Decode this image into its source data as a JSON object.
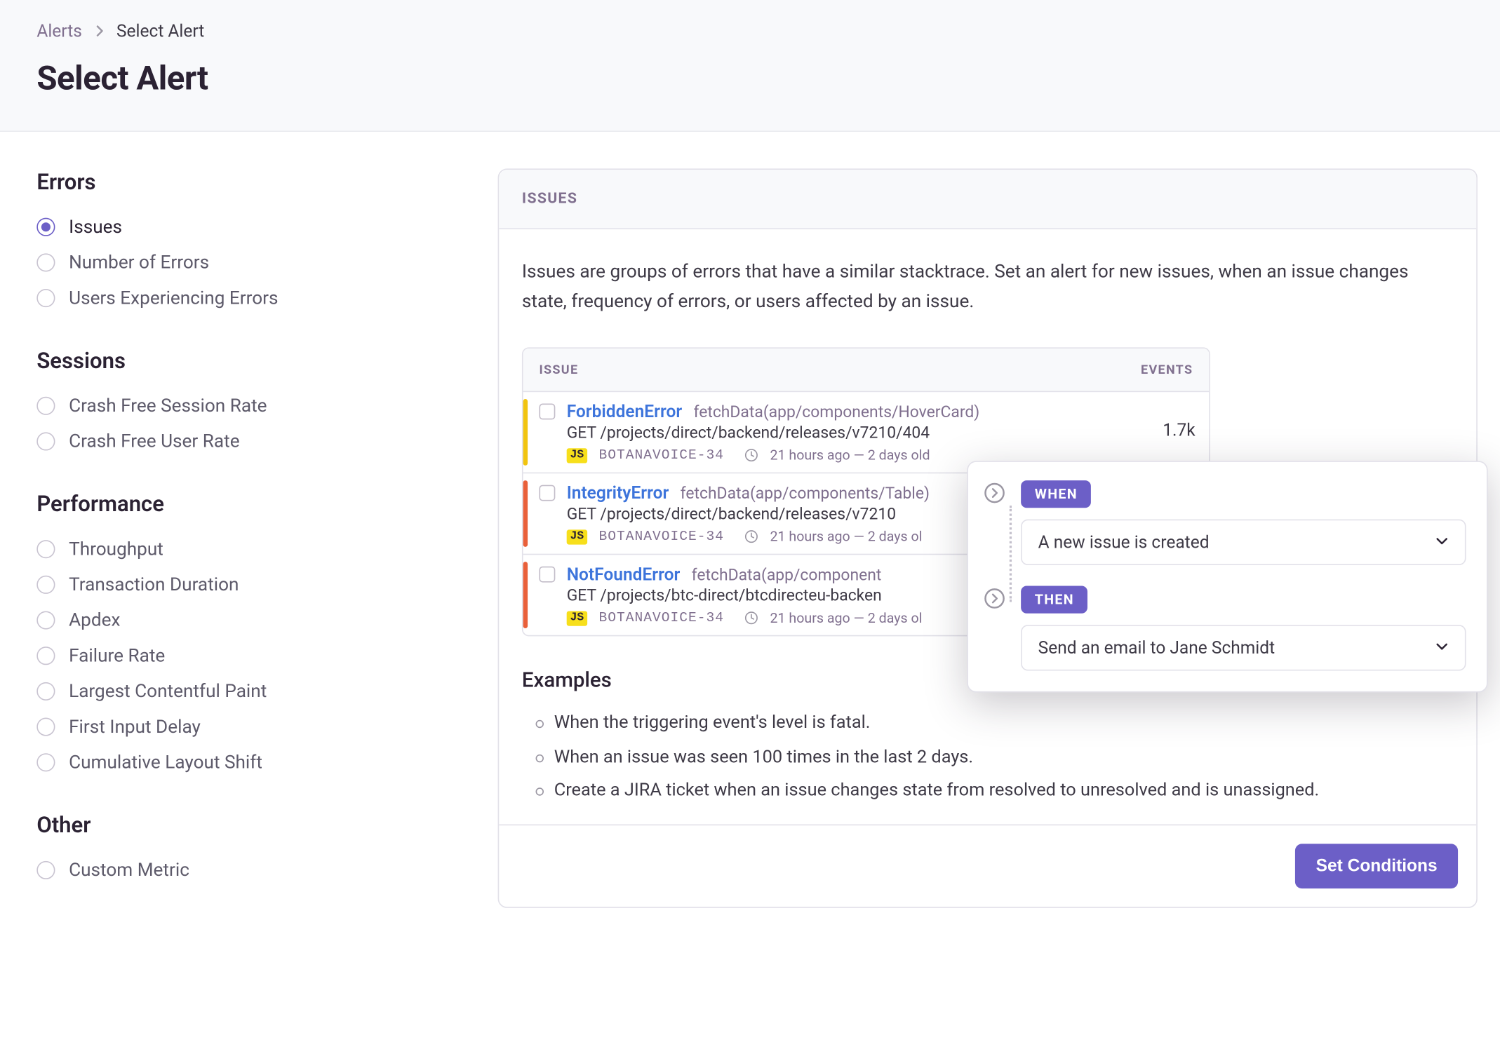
{
  "breadcrumb": {
    "trail": [
      "Alerts"
    ],
    "current": "Select Alert"
  },
  "page": {
    "title": "Select Alert"
  },
  "sidebar": {
    "groups": [
      {
        "title": "Errors",
        "items": [
          {
            "label": "Issues",
            "selected": true
          },
          {
            "label": "Number of Errors",
            "selected": false
          },
          {
            "label": "Users Experiencing Errors",
            "selected": false
          }
        ]
      },
      {
        "title": "Sessions",
        "items": [
          {
            "label": "Crash Free Session Rate",
            "selected": false
          },
          {
            "label": "Crash Free User Rate",
            "selected": false
          }
        ]
      },
      {
        "title": "Performance",
        "items": [
          {
            "label": "Throughput",
            "selected": false
          },
          {
            "label": "Transaction Duration",
            "selected": false
          },
          {
            "label": "Apdex",
            "selected": false
          },
          {
            "label": "Failure Rate",
            "selected": false
          },
          {
            "label": "Largest Contentful Paint",
            "selected": false
          },
          {
            "label": "First Input Delay",
            "selected": false
          },
          {
            "label": "Cumulative Layout Shift",
            "selected": false
          }
        ]
      },
      {
        "title": "Other",
        "items": [
          {
            "label": "Custom Metric",
            "selected": false
          }
        ]
      }
    ]
  },
  "panel": {
    "header": "ISSUES",
    "description": "Issues are groups of errors that have a similar stacktrace. Set an alert for new issues, when an issue changes state, frequency of errors, or users affected by an issue.",
    "issuesTable": {
      "columns": {
        "issue": "ISSUE",
        "events": "EVENTS"
      },
      "rows": [
        {
          "level": "warn",
          "name": "ForbiddenError",
          "fn": "fetchData(app/components/HoverCard)",
          "path": "GET /projects/direct/backend/releases/v7210/404",
          "platformBadge": "JS",
          "project": "BOTANAVOICE-34",
          "time": "21 hours ago — 2 days old",
          "events": "1.7k"
        },
        {
          "level": "err",
          "name": "IntegrityError",
          "fn": "fetchData(app/components/Table)",
          "path": "GET /projects/direct/backend/releases/v7210",
          "platformBadge": "JS",
          "project": "BOTANAVOICE-34",
          "time": "21 hours ago — 2 days ol",
          "events": ""
        },
        {
          "level": "err",
          "name": "NotFoundError",
          "fn": "fetchData(app/component",
          "path": "GET /projects/btc-direct/btcdirecteu-backen",
          "platformBadge": "JS",
          "project": "BOTANAVOICE-34",
          "time": "21 hours ago — 2 days ol",
          "events": ""
        }
      ]
    },
    "planner": {
      "when": {
        "badge": "WHEN",
        "value": "A new issue is created"
      },
      "then": {
        "badge": "THEN",
        "value": "Send an email to Jane Schmidt"
      }
    },
    "examples": {
      "title": "Examples",
      "items": [
        "When the triggering event's level is fatal.",
        "When an issue was seen 100 times in the last 2 days.",
        "Create a JIRA ticket when an issue changes state from resolved to unresolved and is unassigned."
      ]
    },
    "cta": "Set Conditions"
  }
}
